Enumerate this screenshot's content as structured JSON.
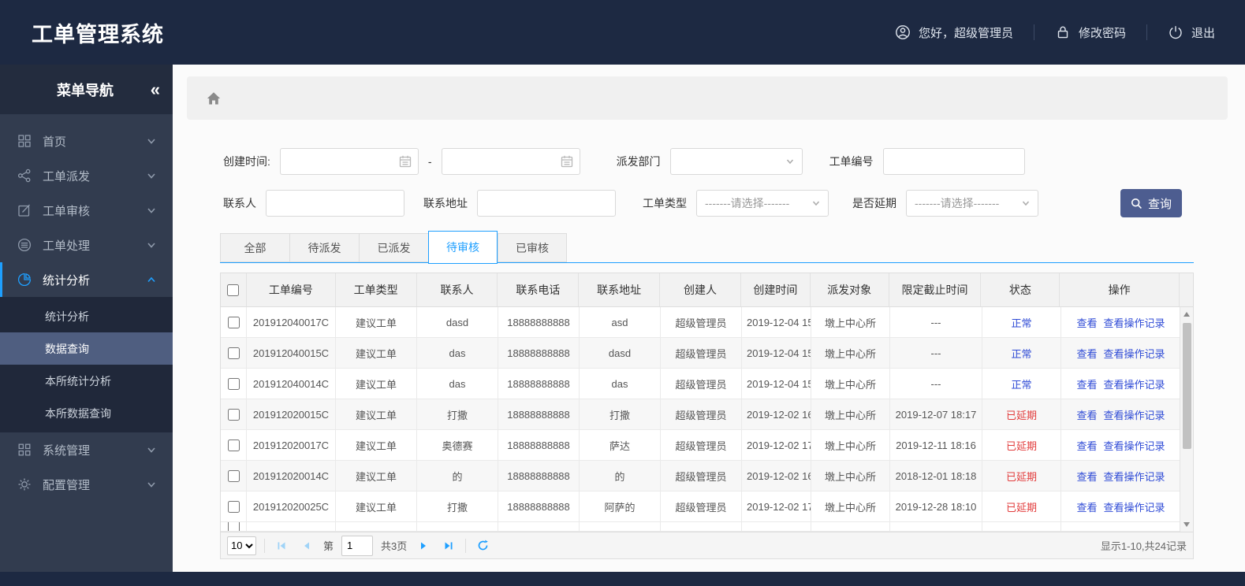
{
  "header": {
    "title": "工单管理系统",
    "greeting": "您好，超级管理员",
    "change_password": "修改密码",
    "logout": "退出"
  },
  "sidebar": {
    "title": "菜单导航",
    "collapse_glyph": "«",
    "items": [
      {
        "label": "首页"
      },
      {
        "label": "工单派发"
      },
      {
        "label": "工单审核"
      },
      {
        "label": "工单处理"
      },
      {
        "label": "统计分析",
        "expanded": true,
        "children": [
          "统计分析",
          "数据查询",
          "本所统计分析",
          "本所数据查询"
        ],
        "active_child": "数据查询"
      },
      {
        "label": "系统管理"
      },
      {
        "label": "配置管理"
      }
    ]
  },
  "filters": {
    "create_time_label": "创建时间:",
    "date_from_value": "",
    "date_to_value": "",
    "date_separator": "-",
    "dispatch_dept_label": "派发部门",
    "dispatch_dept_value": "",
    "order_no_label": "工单编号",
    "order_no_value": "",
    "contact_label": "联系人",
    "contact_value": "",
    "address_label": "联系地址",
    "address_value": "",
    "order_type_label": "工单类型",
    "delay_label": "是否延期",
    "select_placeholder": "-------请选择-------",
    "search_button": "查询"
  },
  "tabs": {
    "items": [
      "全部",
      "待派发",
      "已派发",
      "待审核",
      "已审核"
    ],
    "active": "待审核"
  },
  "table": {
    "columns": [
      "工单编号",
      "工单类型",
      "联系人",
      "联系电话",
      "联系地址",
      "创建人",
      "创建时间",
      "派发对象",
      "限定截止时间",
      "状态",
      "操作"
    ],
    "view_label": "查看",
    "log_label": "查看操作记录",
    "rows": [
      {
        "order_no": "201912040017C",
        "type": "建议工单",
        "contact": "dasd",
        "phone": "18888888888",
        "address": "asd",
        "creator": "超级管理员",
        "created": "2019-12-04 15",
        "target": "墩上中心所",
        "deadline": "---",
        "status": "正常",
        "status_color": "blue"
      },
      {
        "order_no": "201912040015C",
        "type": "建议工单",
        "contact": "das",
        "phone": "18888888888",
        "address": "dasd",
        "creator": "超级管理员",
        "created": "2019-12-04 15",
        "target": "墩上中心所",
        "deadline": "---",
        "status": "正常",
        "status_color": "blue"
      },
      {
        "order_no": "201912040014C",
        "type": "建议工单",
        "contact": "das",
        "phone": "18888888888",
        "address": "das",
        "creator": "超级管理员",
        "created": "2019-12-04 15",
        "target": "墩上中心所",
        "deadline": "---",
        "status": "正常",
        "status_color": "blue"
      },
      {
        "order_no": "201912020015C",
        "type": "建议工单",
        "contact": "打撒",
        "phone": "18888888888",
        "address": "打撒",
        "creator": "超级管理员",
        "created": "2019-12-02 16",
        "target": "墩上中心所",
        "deadline": "2019-12-07 18:17",
        "status": "已延期",
        "status_color": "red"
      },
      {
        "order_no": "201912020017C",
        "type": "建议工单",
        "contact": "奥德赛",
        "phone": "18888888888",
        "address": "萨达",
        "creator": "超级管理员",
        "created": "2019-12-02 17",
        "target": "墩上中心所",
        "deadline": "2019-12-11 18:16",
        "status": "已延期",
        "status_color": "red"
      },
      {
        "order_no": "201912020014C",
        "type": "建议工单",
        "contact": "的",
        "phone": "18888888888",
        "address": "的",
        "creator": "超级管理员",
        "created": "2019-12-02 16",
        "target": "墩上中心所",
        "deadline": "2018-12-01 18:18",
        "status": "已延期",
        "status_color": "red"
      },
      {
        "order_no": "201912020025C",
        "type": "建议工单",
        "contact": "打撒",
        "phone": "18888888888",
        "address": "阿萨的",
        "creator": "超级管理员",
        "created": "2019-12-02 17",
        "target": "墩上中心所",
        "deadline": "2019-12-28 18:10",
        "status": "已延期",
        "status_color": "red"
      }
    ]
  },
  "pagination": {
    "page_size": "10",
    "page_prefix": "第",
    "current_page": "1",
    "total_pages": "共3页",
    "summary": "显示1-10,共24记录"
  },
  "colors": {
    "topbar_bg": "#1d2942",
    "sidebar_bg": "#323c4f",
    "accent_blue": "#1e9fff",
    "search_button_bg": "#4d5d90",
    "status_normal": "#2f4bd6",
    "status_delayed": "#e23c3c",
    "link_blue": "#2f4bd6"
  }
}
